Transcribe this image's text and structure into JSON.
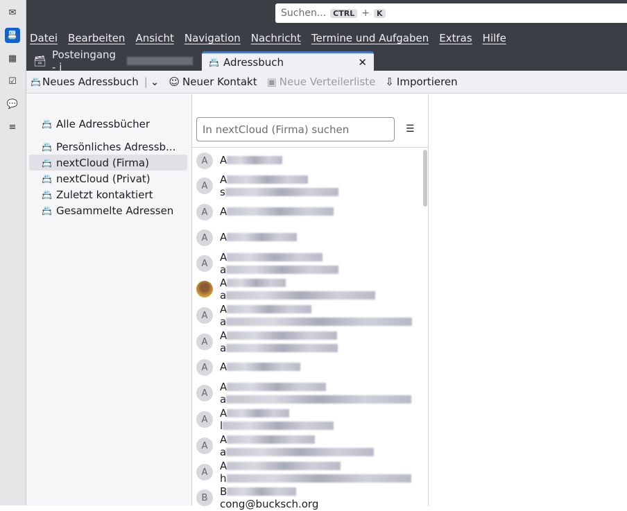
{
  "spaces": [
    {
      "name": "mail-icon",
      "glyph": "✉"
    },
    {
      "name": "address-book-icon",
      "glyph": "📇"
    },
    {
      "name": "calendar-icon",
      "glyph": "▦"
    },
    {
      "name": "tasks-icon",
      "glyph": "☑"
    },
    {
      "name": "chat-icon",
      "glyph": "💬"
    },
    {
      "name": "settings-icon",
      "glyph": "≡"
    }
  ],
  "search": {
    "placeholder": "Suchen...",
    "key1": "CTRL",
    "plus": "+",
    "key2": "K"
  },
  "menu": [
    "Datei",
    "Bearbeiten",
    "Ansicht",
    "Navigation",
    "Nachricht",
    "Termine und Aufgaben",
    "Extras",
    "Hilfe"
  ],
  "tabs": [
    {
      "label": "Posteingang - i"
    },
    {
      "label": "Adressbuch",
      "close": "✕"
    }
  ],
  "toolbar": {
    "new_book": "Neues Adressbuch",
    "new_contact": "Neuer Kontakt",
    "new_list": "Neue Verteilerliste",
    "import": "Importieren"
  },
  "books": [
    "Alle Adressbücher",
    "Persönliches Adressb...",
    "nextCloud (Firma)",
    "nextCloud (Privat)",
    "Zuletzt kontaktiert",
    "Gesammelte Adressen"
  ],
  "list": {
    "search_placeholder": "In nextCloud (Firma) suchen",
    "contacts": [
      {
        "a": "A",
        "n": "A",
        "e": ""
      },
      {
        "a": "A",
        "n": "A",
        "e": "s"
      },
      {
        "a": "A",
        "n": "A",
        "e": ""
      },
      {
        "a": "A",
        "n": "A",
        "e": ""
      },
      {
        "a": "A",
        "n": "A",
        "e": "a"
      },
      {
        "a": "",
        "n": "A",
        "e": "a"
      },
      {
        "a": "A",
        "n": "A",
        "e": "a"
      },
      {
        "a": "A",
        "n": "A",
        "e": "a"
      },
      {
        "a": "A",
        "n": "A",
        "e": ""
      },
      {
        "a": "A",
        "n": "A",
        "e": "a"
      },
      {
        "a": "A",
        "n": "A",
        "e": "l"
      },
      {
        "a": "A",
        "n": "A",
        "e": "a"
      },
      {
        "a": "A",
        "n": "A",
        "e": "h"
      },
      {
        "a": "B",
        "n": "B",
        "e": "cong@bucksch.org"
      }
    ]
  }
}
